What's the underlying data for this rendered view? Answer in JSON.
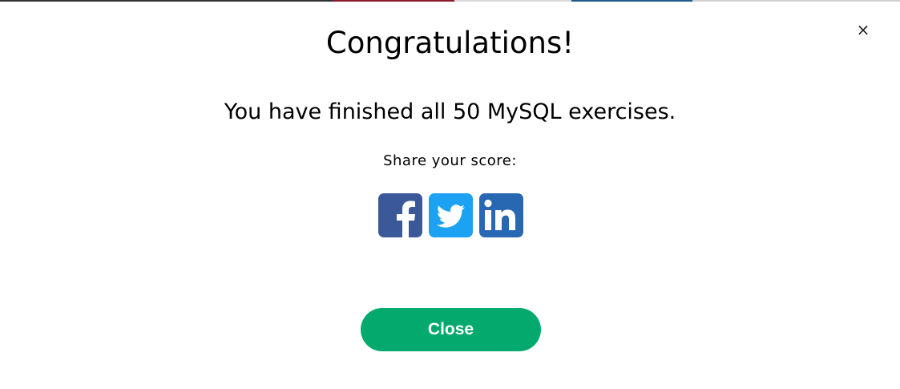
{
  "dialog": {
    "close_glyph": "×",
    "title": "Congratulations!",
    "message": "You have finished all 50 MySQL exercises.",
    "share_label": "Share your score:",
    "close_button_label": "Close"
  },
  "share_buttons": [
    {
      "icon": "facebook-icon",
      "color": "#3b5998"
    },
    {
      "icon": "twitter-icon",
      "color": "#1da1f2"
    },
    {
      "icon": "linkedin-icon",
      "color": "#2867b2"
    }
  ],
  "colors": {
    "accent": "#04aa6d",
    "text": "#000000",
    "background": "#ffffff"
  }
}
